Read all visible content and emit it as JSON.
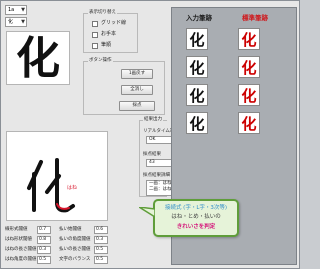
{
  "top_selects": {
    "kanji_set": "1a",
    "character": "化"
  },
  "preview": {
    "character": "化"
  },
  "display_group": {
    "title": "表示切り替え",
    "options": [
      {
        "label": "グリッド線",
        "checked": false
      },
      {
        "label": "お手本",
        "checked": false
      },
      {
        "label": "筆順",
        "checked": false
      }
    ]
  },
  "button_group": {
    "title": "ボタン操作",
    "buttons": [
      "1画戻す",
      "全消し",
      "採点"
    ]
  },
  "results_group": {
    "title": "結果出力",
    "realtime_label": "リアルタイム筆順判定",
    "realtime_value": "OK",
    "score_label": "採点結果",
    "score_value": "43",
    "detail_label": "採点結果詳細",
    "detail_lines": [
      "一画：はね (137, 123)",
      "二画：はね (171, 130)"
    ]
  },
  "canvas": {
    "character": "化",
    "annotation": "はね"
  },
  "params": [
    {
      "label": "線形式閾値",
      "value": "0.7"
    },
    {
      "label": "はね形状閾値",
      "value": "0.8"
    },
    {
      "label": "はねの長さ閾値",
      "value": "0.3"
    },
    {
      "label": "はね角度の閾値",
      "value": "0.5"
    },
    {
      "label": "払い始閾値",
      "value": "0.6"
    },
    {
      "label": "払いの角度閾値",
      "value": "0.3"
    },
    {
      "label": "払いの長さ閾値",
      "value": "0.5"
    },
    {
      "label": "文字のバランス",
      "value": "0.5"
    }
  ],
  "panel": {
    "header_input": "入力筆跡",
    "header_standard": "標準筆跡",
    "colors": {
      "header_input": "#1a1a1a",
      "header_standard": "#d0161a"
    },
    "rows": 4
  },
  "callout": {
    "line1": "接続式 (字・L字・3次等)",
    "line2": "はね・とめ・払いの",
    "line3": "きれいさを判定"
  }
}
